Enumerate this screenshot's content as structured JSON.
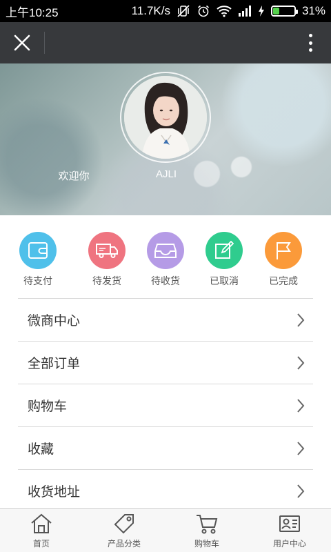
{
  "status_bar": {
    "time": "上午10:25",
    "network_speed": "11.7K/s",
    "battery_percent": "31%",
    "battery_level": 0.31,
    "icons": [
      "vibrate-off-icon",
      "alarm-icon",
      "wifi-icon",
      "signal-icon",
      "charging-icon",
      "battery-icon"
    ]
  },
  "title_bar": {
    "close_icon": "close-icon",
    "more_icon": "more-vertical-icon"
  },
  "profile": {
    "welcome": "欢迎你",
    "username": "AJLI"
  },
  "order_status": [
    {
      "label": "待支付",
      "icon": "wallet-icon",
      "color": "#4fc0ea"
    },
    {
      "label": "待发货",
      "icon": "truck-icon",
      "color": "#ef7480"
    },
    {
      "label": "待收货",
      "icon": "inbox-icon",
      "color": "#b59be6"
    },
    {
      "label": "已取消",
      "icon": "edit-icon",
      "color": "#2fcc8e"
    },
    {
      "label": "已完成",
      "icon": "flag-icon",
      "color": "#fb9a3a"
    }
  ],
  "menu": [
    {
      "label": "微商中心"
    },
    {
      "label": "全部订单"
    },
    {
      "label": "购物车"
    },
    {
      "label": "收藏"
    },
    {
      "label": "收货地址"
    }
  ],
  "bottom_nav": [
    {
      "label": "首页",
      "icon": "home-icon"
    },
    {
      "label": "产品分类",
      "icon": "tag-icon"
    },
    {
      "label": "购物车",
      "icon": "cart-icon"
    },
    {
      "label": "用户中心",
      "icon": "user-card-icon"
    }
  ]
}
